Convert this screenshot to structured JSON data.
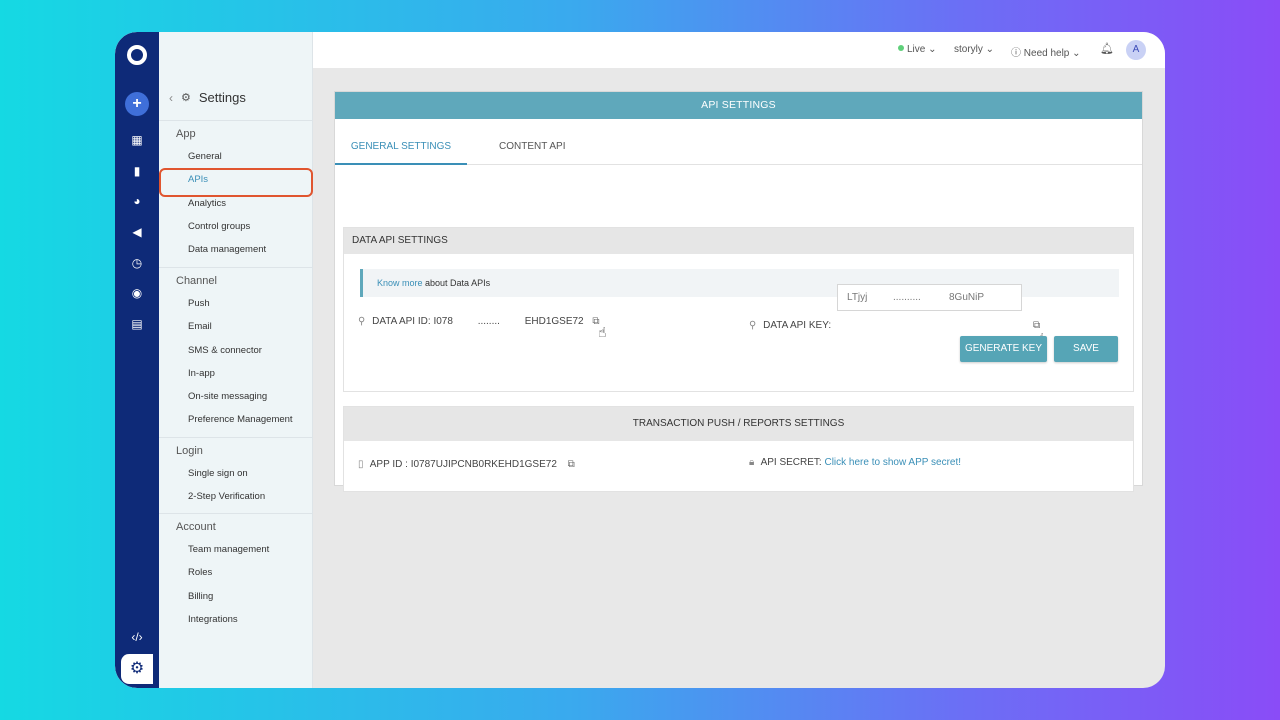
{
  "topbar": {
    "env": "Live",
    "workspace": "storyly",
    "help": "Need help",
    "avatar": "A"
  },
  "settings": {
    "title": "Settings",
    "sections": [
      {
        "title": "App",
        "items": [
          "General",
          "APIs",
          "Analytics",
          "Control groups",
          "Data management"
        ]
      },
      {
        "title": "Channel",
        "items": [
          "Push",
          "Email",
          "SMS & connector",
          "In-app",
          "On-site messaging",
          "Preference Management"
        ]
      },
      {
        "title": "Login",
        "items": [
          "Single sign on",
          "2-Step Verification"
        ]
      },
      {
        "title": "Account",
        "items": [
          "Team management",
          "Roles",
          "Billing",
          "Integrations"
        ]
      }
    ],
    "active_item": "APIs"
  },
  "panel": {
    "title": "API SETTINGS",
    "tabs": [
      "GENERAL SETTINGS",
      "CONTENT API"
    ],
    "data_api": {
      "heading": "DATA API SETTINGS",
      "info_link": "Know more",
      "info_text": " about Data APIs",
      "id_label": "DATA API ID:",
      "id_start": "I078",
      "id_dots": "........",
      "id_end": "EHD1GSE72",
      "key_label": "DATA API KEY:",
      "key_start": "LTjyj",
      "key_dots": "..........",
      "key_end": "8GuNiP",
      "generate_button": "GENERATE KEY",
      "save_button": "SAVE"
    },
    "transaction": {
      "heading": "TRANSACTION PUSH / REPORTS SETTINGS",
      "app_id_label": "APP ID :",
      "app_id_value": "I0787UJIPCNB0RKEHD1GSE72",
      "secret_label": "API SECRET:",
      "secret_link": "Click here to show APP secret!"
    }
  }
}
